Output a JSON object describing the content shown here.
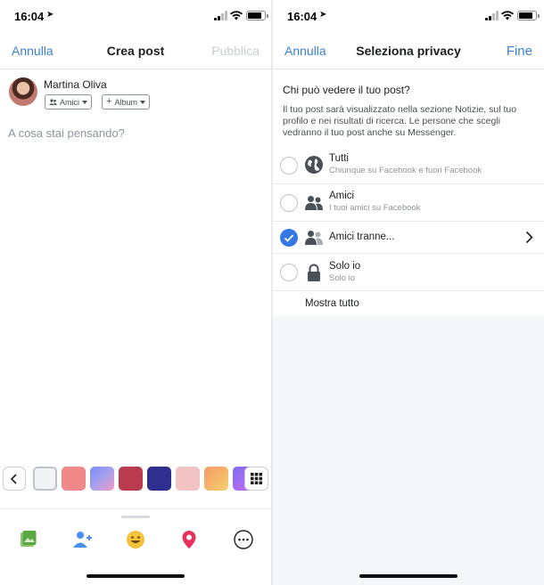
{
  "status_bar": {
    "time": "16:04"
  },
  "compose": {
    "cancel_label": "Annulla",
    "title": "Crea post",
    "publish_label": "Pubblica",
    "author_name": "Martina Oliva",
    "audience_label": "Amici",
    "album_label": "Album",
    "placeholder": "A cosa stai pensando?",
    "background_swatches": [
      {
        "color": "#f2f3f5",
        "icon": "blank-swatch"
      },
      {
        "color": "#f08a8a",
        "icon": "rose-swatch"
      },
      {
        "color": "#a7a0ee",
        "icon": "gradient-swatch"
      },
      {
        "color": "#b83b4f",
        "icon": "heart-swatch"
      },
      {
        "color": "#2f2f8f",
        "icon": "cake-swatch"
      },
      {
        "color": "#f2c3c3",
        "icon": "pink-swatch"
      },
      {
        "color": "#f7b26a",
        "icon": "sunset-swatch"
      },
      {
        "color": "#d26cf0",
        "icon": "purple-swatch"
      }
    ],
    "tray_icons": [
      "photo-icon",
      "tag-people-icon",
      "feeling-icon",
      "location-icon",
      "more-icon"
    ]
  },
  "privacy": {
    "cancel_label": "Annulla",
    "title": "Seleziona privacy",
    "done_label": "Fine",
    "question": "Chi può vedere il tuo post?",
    "description": "Il tuo post sarà visualizzato nella sezione Notizie, sul tuo profilo e nei risultati di ricerca. Le persone che scegli vedranno il tuo post anche su Messenger.",
    "options": [
      {
        "title": "Tutti",
        "subtitle": "Chiunque su Facebook e fuori Facebook",
        "icon": "globe-icon",
        "selected": false
      },
      {
        "title": "Amici",
        "subtitle": "I tuoi amici su Facebook",
        "icon": "friends-icon",
        "selected": false
      },
      {
        "title": "Amici tranne...",
        "subtitle": "",
        "icon": "friends-except-icon",
        "selected": true
      },
      {
        "title": "Solo io",
        "subtitle": "Solo io",
        "icon": "lock-icon",
        "selected": false
      }
    ],
    "show_all_label": "Mostra tutto"
  },
  "colors": {
    "accent": "#3578e5",
    "link": "#3b82d6",
    "disabled": "#c8ccd2"
  }
}
